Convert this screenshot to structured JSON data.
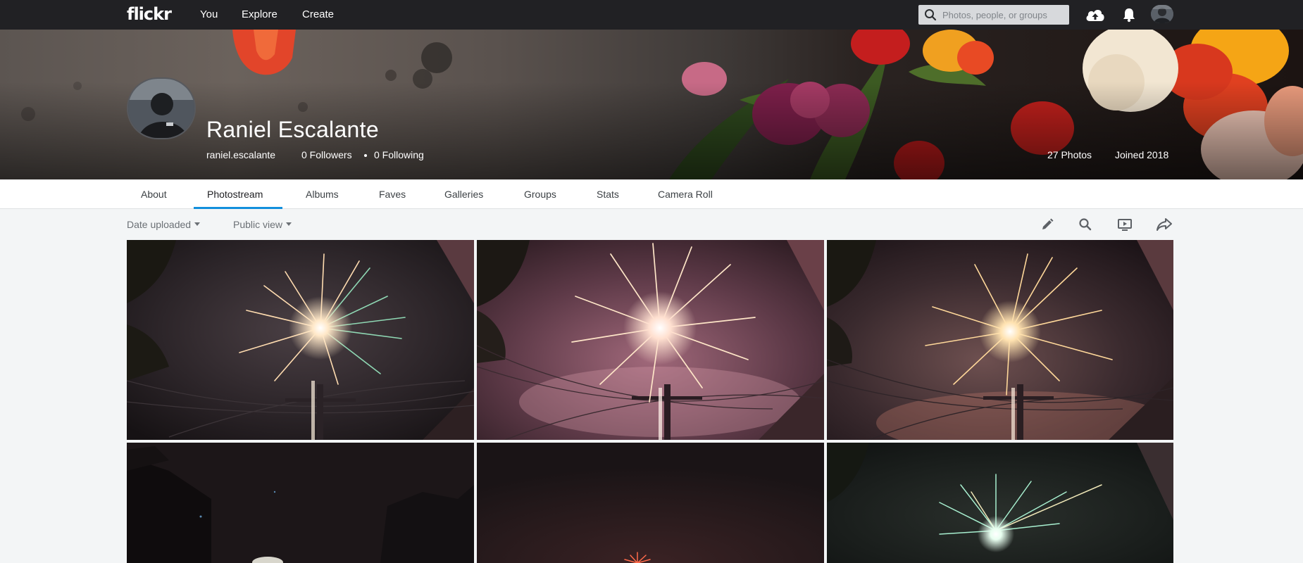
{
  "topnav": {
    "logo": "flickr",
    "links": [
      "You",
      "Explore",
      "Create"
    ],
    "search_placeholder": "Photos, people, or groups",
    "icons": [
      "upload-icon",
      "bell-icon",
      "avatar"
    ]
  },
  "profile": {
    "name": "Raniel Escalante",
    "username": "raniel.escalante",
    "followers": "0 Followers",
    "following": "0 Following",
    "photos": "27 Photos",
    "joined": "Joined 2018"
  },
  "tabs": [
    "About",
    "Photostream",
    "Albums",
    "Faves",
    "Galleries",
    "Groups",
    "Stats",
    "Camera Roll"
  ],
  "active_tab": "Photostream",
  "toolbar": {
    "sort": "Date uploaded",
    "view": "Public view",
    "icons": [
      "edit-icon",
      "search-icon",
      "slideshow-icon",
      "share-icon"
    ]
  },
  "photos": [
    {
      "subject": "firework-burst",
      "palette": "gold-green"
    },
    {
      "subject": "firework-burst",
      "palette": "pink"
    },
    {
      "subject": "firework-burst",
      "palette": "gold"
    },
    {
      "subject": "night-street",
      "palette": "dark"
    },
    {
      "subject": "night-sky",
      "palette": "dark-red"
    },
    {
      "subject": "firework-burst",
      "palette": "white-green"
    }
  ],
  "colors": {
    "topbar": "#212124",
    "accent": "#128fdc",
    "page_bg": "#f3f5f6"
  }
}
